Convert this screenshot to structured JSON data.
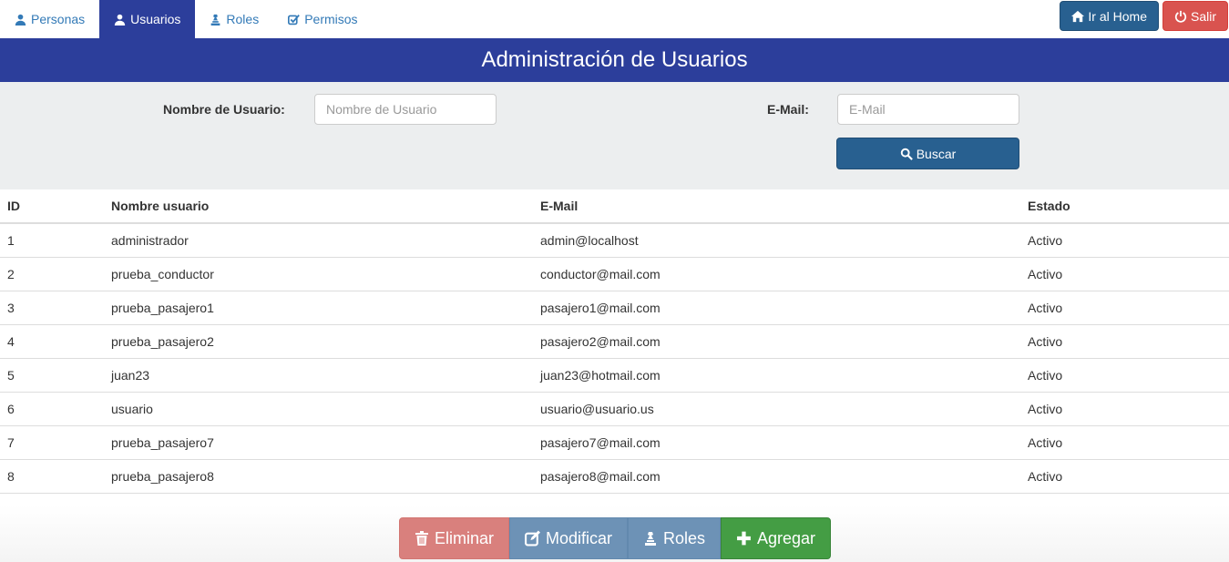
{
  "tabs": [
    {
      "label": "Personas",
      "icon": "user-icon"
    },
    {
      "label": "Usuarios",
      "icon": "user-icon"
    },
    {
      "label": "Roles",
      "icon": "chess-piece-icon"
    },
    {
      "label": "Permisos",
      "icon": "checkbox-icon"
    }
  ],
  "header_actions": {
    "home_label": "Ir al Home",
    "exit_label": "Salir"
  },
  "page": {
    "title": "Administración de Usuarios"
  },
  "filters": {
    "username_label": "Nombre de Usuario:",
    "username_placeholder": "Nombre de Usuario",
    "username_value": "",
    "email_label": "E-Mail:",
    "email_placeholder": "E-Mail",
    "email_value": "",
    "search_label": "Buscar"
  },
  "table": {
    "columns": [
      "ID",
      "Nombre usuario",
      "E-Mail",
      "Estado"
    ],
    "rows": [
      [
        "1",
        "administrador",
        "admin@localhost",
        "Activo"
      ],
      [
        "2",
        "prueba_conductor",
        "conductor@mail.com",
        "Activo"
      ],
      [
        "3",
        "prueba_pasajero1",
        "pasajero1@mail.com",
        "Activo"
      ],
      [
        "4",
        "prueba_pasajero2",
        "pasajero2@mail.com",
        "Activo"
      ],
      [
        "5",
        "juan23",
        "juan23@hotmail.com",
        "Activo"
      ],
      [
        "6",
        "usuario",
        "usuario@usuario.us",
        "Activo"
      ],
      [
        "7",
        "prueba_pasajero7",
        "pasajero7@mail.com",
        "Activo"
      ],
      [
        "8",
        "prueba_pasajero8",
        "pasajero8@mail.com",
        "Activo"
      ]
    ]
  },
  "actions": {
    "delete_label": "Eliminar",
    "modify_label": "Modificar",
    "roles_label": "Roles",
    "add_label": "Agregar"
  },
  "colors": {
    "primary": "#2c3e9b",
    "button_blue": "#286090",
    "danger": "#d9534f",
    "success": "#449d44",
    "filter_bg": "#eceeef"
  }
}
